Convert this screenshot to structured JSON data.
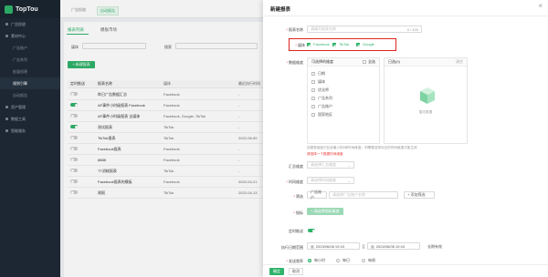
{
  "brand": {
    "name": "TopTou",
    "accent": "#2fb36a",
    "highlight": "#e0251b"
  },
  "sidebar": {
    "items": [
      {
        "label": "广告投放",
        "icon": "megaphone-icon",
        "sub": false,
        "active": false
      },
      {
        "label": "素材中心",
        "icon": "folder-icon",
        "sub": false,
        "active": false
      },
      {
        "label": "广告账户",
        "icon": "",
        "sub": true,
        "active": false
      },
      {
        "label": "广告系列",
        "icon": "",
        "sub": true,
        "active": false
      },
      {
        "label": "批量创建",
        "icon": "",
        "sub": true,
        "active": false
      },
      {
        "label": "规则引擎",
        "icon": "",
        "sub": true,
        "active": true
      },
      {
        "label": "自动报告",
        "icon": "",
        "sub": true,
        "active": false
      },
      {
        "label": "资产管理",
        "icon": "asset-icon",
        "sub": false,
        "active": false
      },
      {
        "label": "数据工具",
        "icon": "tool-icon",
        "sub": false,
        "active": false
      },
      {
        "label": "智能服务",
        "icon": "service-icon",
        "sub": false,
        "active": false
      }
    ]
  },
  "topbar": {
    "tabs": [
      {
        "label": "广告投放",
        "active": false
      },
      {
        "label": "自动报告",
        "active": true
      }
    ]
  },
  "content": {
    "tabs": [
      {
        "label": "报表列表",
        "active": true
      },
      {
        "label": "模板市场",
        "active": false
      }
    ],
    "filters": {
      "media_label": "媒体",
      "media_value": "",
      "search_label": "搜索",
      "search_value": ""
    },
    "new_button": "+ 新建报表",
    "columns": [
      "定时推送",
      "报表名称",
      "媒体",
      "最近执行时间"
    ],
    "rows": [
      {
        "on": false,
        "name": "昨日广告数据汇总",
        "media": "Facebook",
        "time": "-"
      },
      {
        "on": true,
        "name": "AF事件小时级报表 Facebook",
        "media": "Facebook",
        "time": "-"
      },
      {
        "on": false,
        "name": "AF事件小时级报表 全媒体",
        "media": "Facebook, Google, TikTok",
        "time": "-"
      },
      {
        "on": true,
        "name": "测试报表",
        "media": "TikTok",
        "time": "-"
      },
      {
        "on": false,
        "name": "TikTok报表",
        "media": "TikTok",
        "time": "2022-06-09"
      },
      {
        "on": false,
        "name": "Facebook报表",
        "media": "Facebook",
        "time": "-"
      },
      {
        "on": false,
        "name": "8888",
        "media": "Facebook",
        "time": "-"
      },
      {
        "on": false,
        "name": "TT消耗报表",
        "media": "TikTok",
        "time": "-"
      },
      {
        "on": false,
        "name": "Facebook报表的模板",
        "media": "Facebook",
        "time": "2022-04-21"
      },
      {
        "on": false,
        "name": "周报",
        "media": "TikTok",
        "time": "2022-04-13"
      }
    ]
  },
  "drawer": {
    "title": "新建报表",
    "name_label": "报表名称",
    "name_placeholder": "请填写报表名称",
    "name_count": "0 / 100",
    "media_label": "媒体",
    "media_options": [
      {
        "label": "Facebook",
        "checked": true
      },
      {
        "label": "TikTok",
        "checked": true
      },
      {
        "label": "Google",
        "checked": true
      }
    ],
    "metrics_label": "数据维度",
    "available_title": "可选择的维度",
    "available_right": "全选",
    "available_items": [
      "日期",
      "媒体",
      "优化师",
      "广告系列",
      "广告账户",
      "国家地区"
    ],
    "selected_title": "已选(0)",
    "selected_right": "清空",
    "empty_text": "暂无数据",
    "hint": "如报表维度已包含最少的4种时间维度，则需要选择对应的时间维度才能生效",
    "warn": "请选择一个数据时间维度",
    "summary_label": "汇总维度",
    "summary_placeholder": "请选择汇总维度",
    "time_label": "时间维度",
    "time_placeholder": "请选择时间维度",
    "filter_label": "筛选",
    "filter_field": "广告账户",
    "filter_placeholder": "请选择广告账户名称",
    "add_filter": "+ 添加筛选",
    "metric_label": "指标",
    "metric_button": "+ 请选择指标维度",
    "push_label": "定时推送",
    "range_label": "执行日期范围",
    "date_start": "2023/06/08 10:43",
    "date_sep": "至",
    "date_end": "2024/06/08 10:43",
    "range_note": "长期有效",
    "freq_label": "发送频率",
    "freq_options": [
      {
        "label": "每小时",
        "checked": true
      },
      {
        "label": "每日",
        "checked": false
      },
      {
        "label": "每周",
        "checked": false
      }
    ],
    "ok": "确定",
    "cancel": "取消"
  }
}
